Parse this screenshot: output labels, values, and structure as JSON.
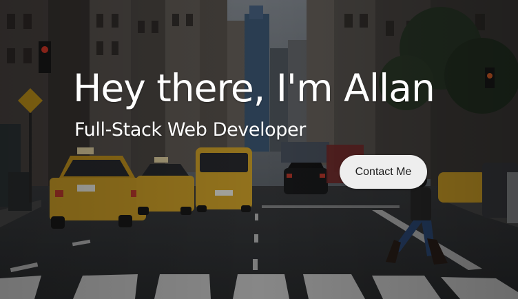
{
  "hero": {
    "title": "Hey there, I'm Allan",
    "subtitle": "Full-Stack Web Developer",
    "cta_label": "Contact Me"
  },
  "colors": {
    "text": "#ffffff",
    "button_bg": "#eeeeee",
    "button_text": "#1b1b1b",
    "taxi_yellow": "#d2a328"
  }
}
